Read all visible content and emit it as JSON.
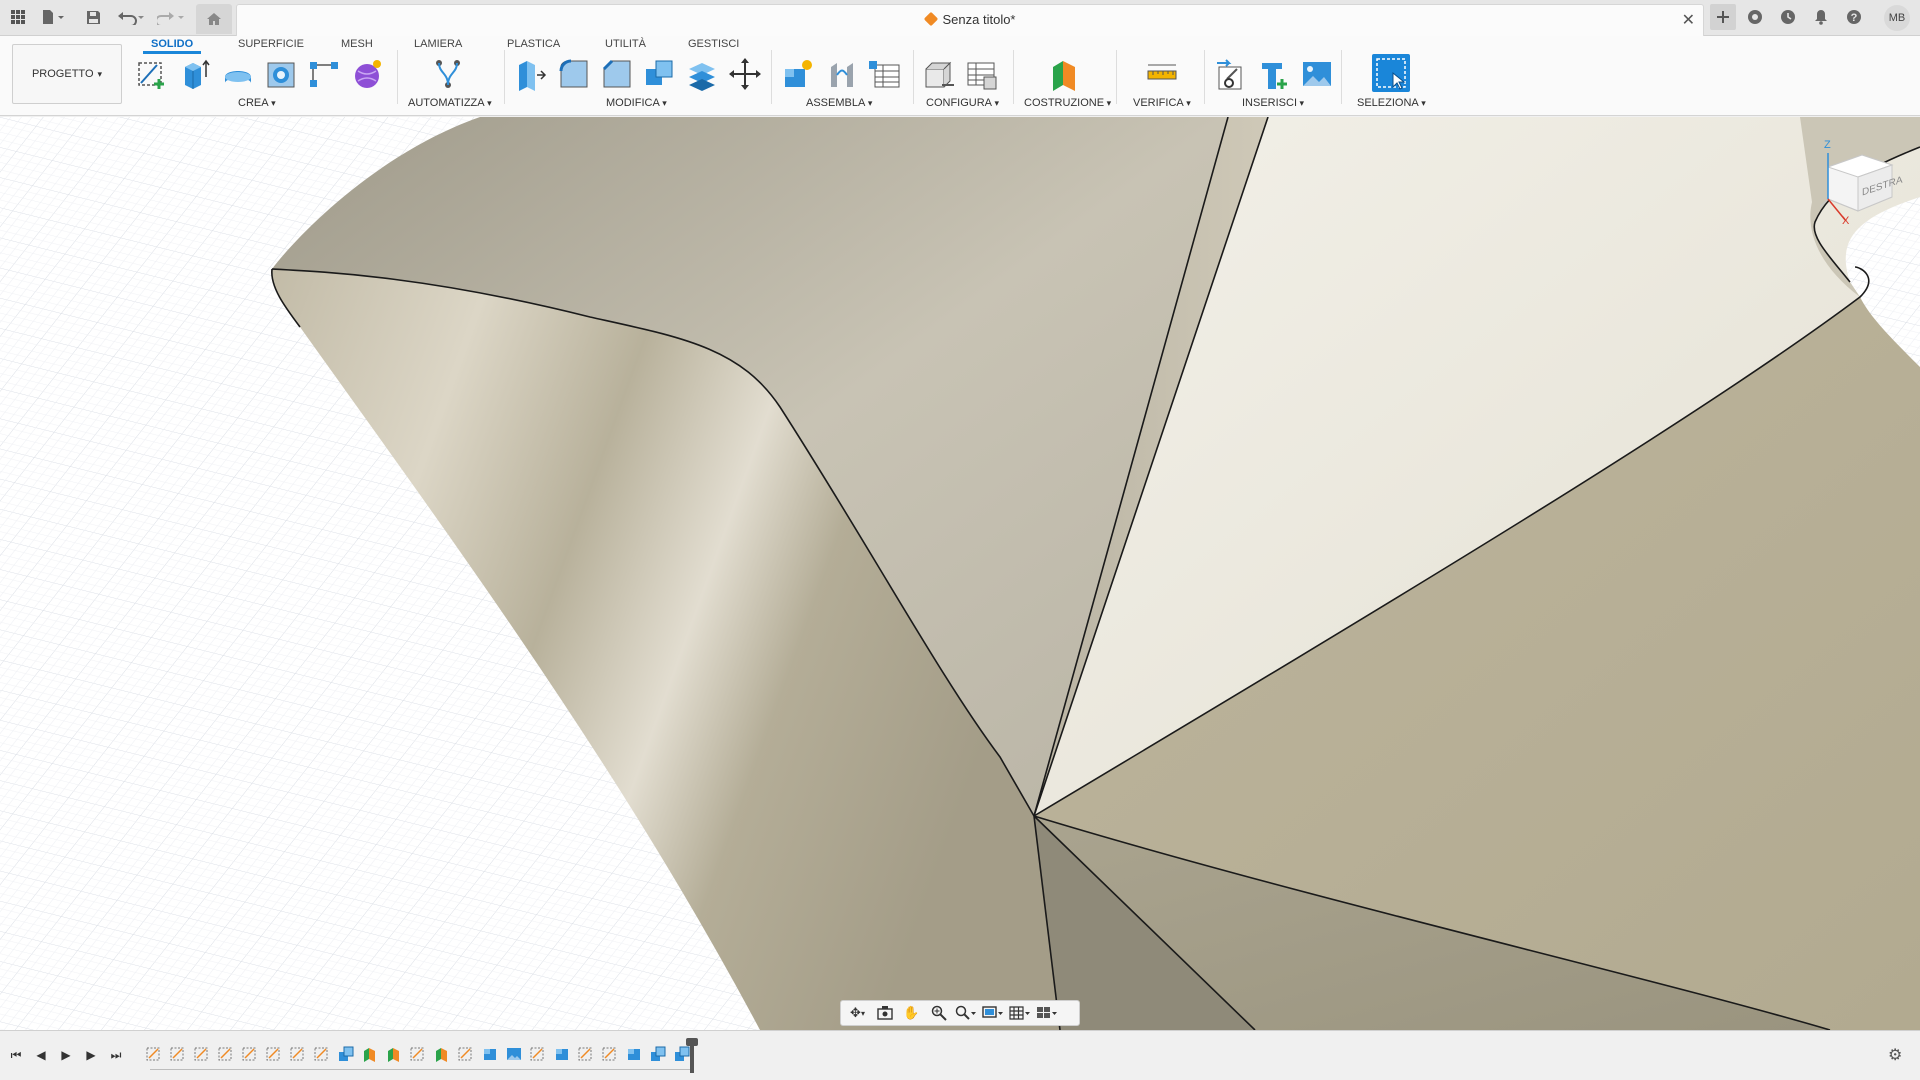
{
  "titlebar": {
    "document_title": "Senza titolo*",
    "icons": [
      "grid-icon",
      "file-icon",
      "save-icon",
      "undo-icon",
      "redo-icon",
      "home-icon",
      "close-icon",
      "plus-icon",
      "extensions-icon",
      "history-icon",
      "notifications-icon",
      "help-icon"
    ],
    "user_initials": "MB"
  },
  "toolbar": {
    "project_label": "PROGETTO",
    "tabs": [
      "SOLIDO",
      "SUPERFICIE",
      "MESH",
      "LAMIERA",
      "PLASTICA",
      "UTILITÀ",
      "GESTISCI"
    ],
    "active_tab": "SOLIDO",
    "groups": [
      "CREA",
      "AUTOMATIZZA",
      "MODIFICA",
      "ASSEMBLA",
      "CONFIGURA",
      "COSTRUZIONE",
      "VERIFICA",
      "INSERISCI",
      "SELEZIONA"
    ]
  },
  "viewcube": {
    "face_label": "DESTRA",
    "axis_z": "Z",
    "axis_x": "X"
  },
  "nav_bar": {
    "icons": [
      "orbit-icon",
      "look-at-icon",
      "pan-icon",
      "zoom-icon",
      "zoom-window-icon",
      "display-mode-icon",
      "grid-icon",
      "viewports-icon"
    ]
  },
  "timeline": {
    "playback_icons": [
      "first-icon",
      "previous-icon",
      "play-icon",
      "next-icon",
      "last-icon"
    ],
    "feature_count": 23
  },
  "colors": {
    "accent": "#1a86d9",
    "model_surface": "#c4bca5",
    "grid_line": "#d9dde5"
  }
}
